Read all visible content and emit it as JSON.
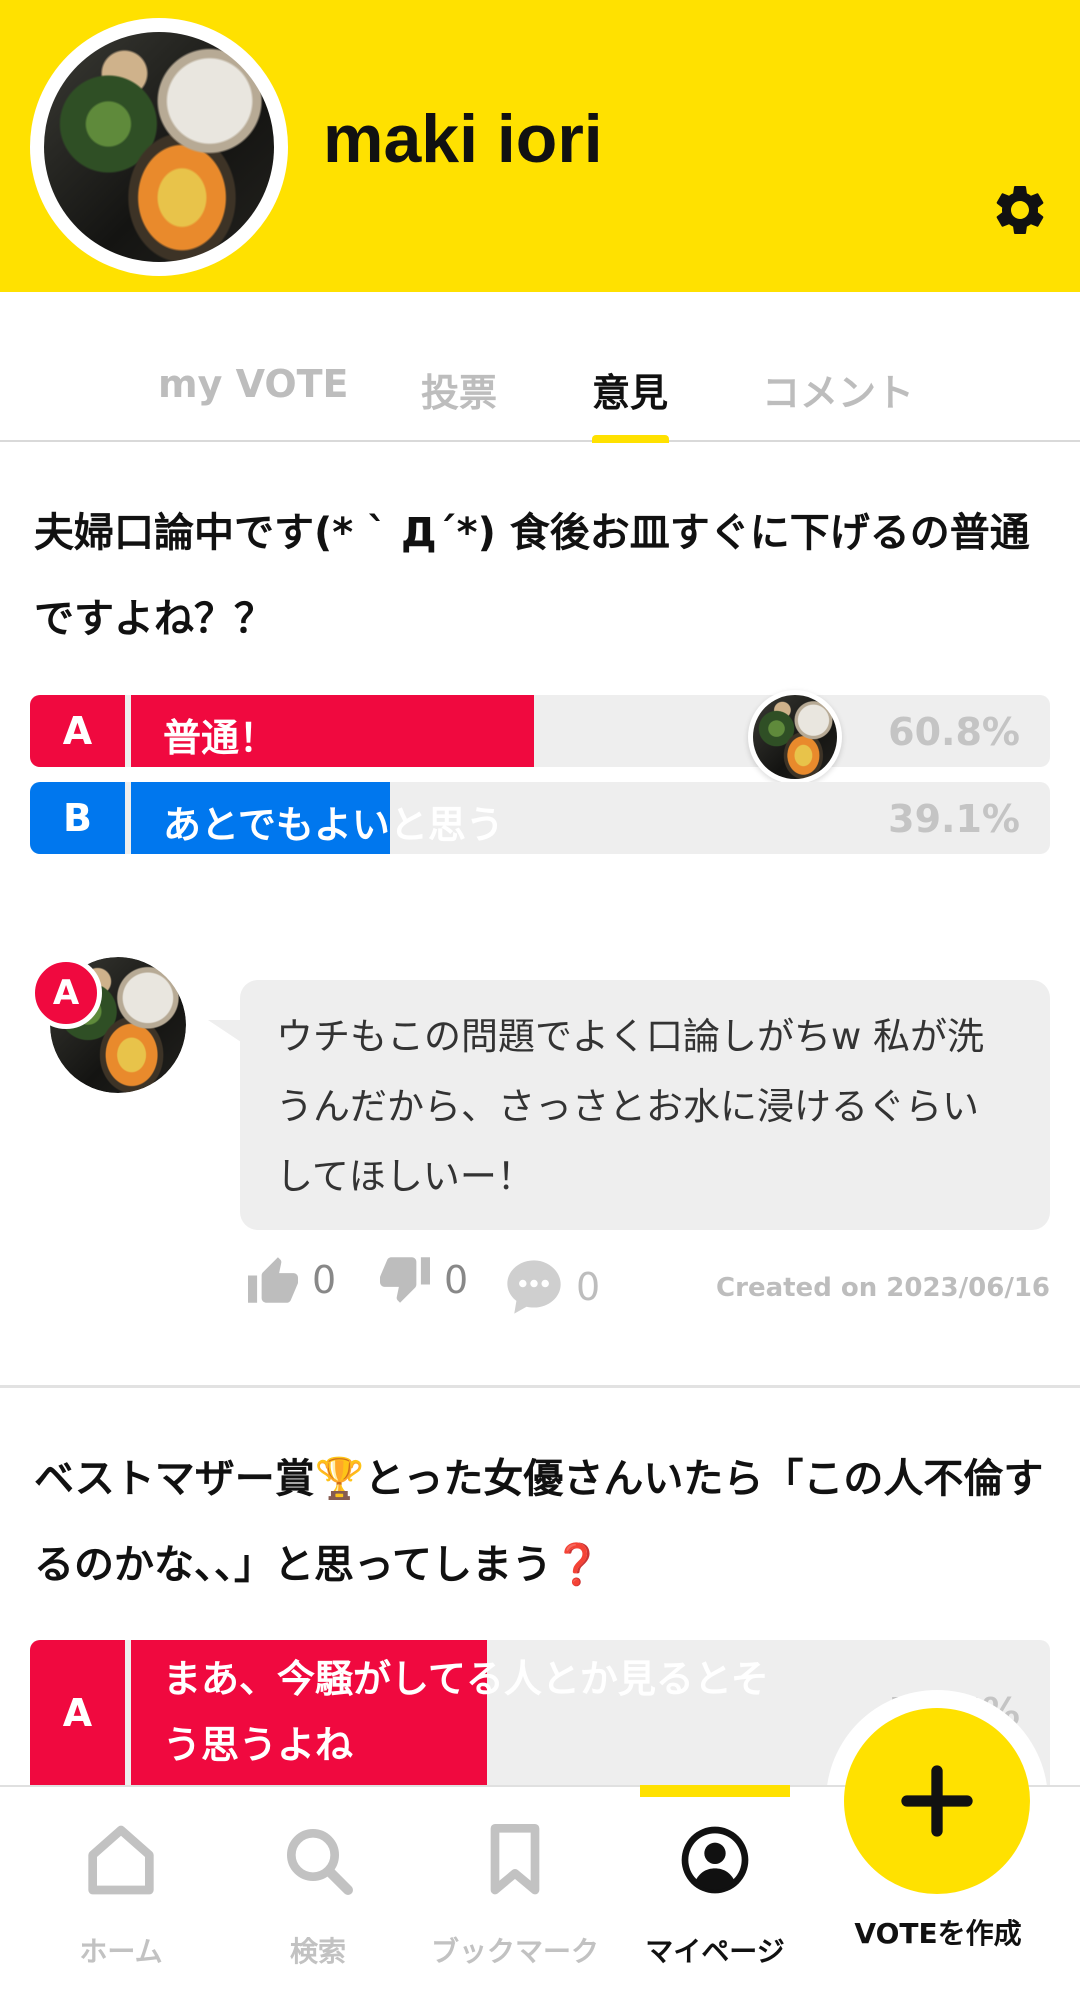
{
  "profile": {
    "username": "maki iori"
  },
  "tabs": [
    {
      "label": "my VOTE"
    },
    {
      "label": "投票"
    },
    {
      "label": "意見"
    },
    {
      "label": "コメント"
    }
  ],
  "vote1": {
    "title": "夫婦口論中です(* ` Д´*) 食後お皿すぐに下げるの普通ですよね？？",
    "options": [
      {
        "letter": "A",
        "label": "普通！",
        "percent": "60.8%",
        "fill": 0.608,
        "color": "#F0093F"
      },
      {
        "letter": "B",
        "label": "あとでもよいと思う",
        "percent": "39.1%",
        "fill": 0.391,
        "color": "#0077EE"
      }
    ]
  },
  "opinion": {
    "badge": "A",
    "text": "ウチもこの問題でよく口論しがちw 私が洗うんだから、さっさとお水に浸けるぐらいしてほしいー！",
    "likes": "0",
    "dislikes": "0",
    "comments": "0",
    "created": "Created on 2023/06/16"
  },
  "vote2": {
    "title": "ベストマザー賞🏆とった女優さんいたら「この人不倫するのかな、、」と思ってしまう❓",
    "options": [
      {
        "letter": "A",
        "label": "まあ、今騒がしてる人とか見るとそう思うよね",
        "percent": "55.5%",
        "color": "#F0093F"
      }
    ]
  },
  "nav": {
    "items": [
      {
        "label": "ホーム",
        "icon": "home-icon"
      },
      {
        "label": "検索",
        "icon": "search-icon"
      },
      {
        "label": "ブックマーク",
        "icon": "bookmark-icon"
      },
      {
        "label": "マイページ",
        "icon": "profile-icon"
      }
    ],
    "create_label": "VOTEを作成"
  },
  "colors": {
    "brand_yellow": "#FFE100",
    "option_a": "#F0093F",
    "option_b": "#0077EE"
  }
}
